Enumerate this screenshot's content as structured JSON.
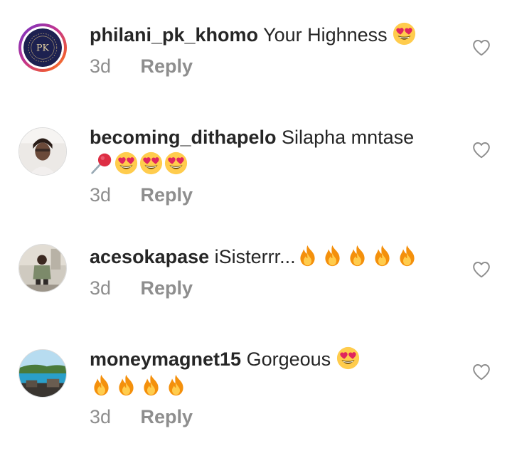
{
  "comments": [
    {
      "username": "philani_pk_khomo",
      "text": "Your Highness",
      "emojis_line1": [
        "heart-eyes-emoji"
      ],
      "emojis_line2": [],
      "time": "3d",
      "reply_label": "Reply",
      "avatar_monogram": "PK",
      "has_story_ring": true
    },
    {
      "username": "becoming_dithapelo",
      "text": "Silapha mntase",
      "emojis_line1": [],
      "emojis_line2": [
        "pushpin-emoji",
        "heart-eyes-emoji",
        "heart-eyes-emoji",
        "heart-eyes-emoji"
      ],
      "time": "3d",
      "reply_label": "Reply",
      "has_story_ring": false
    },
    {
      "username": "acesokapase",
      "text": "iSisterrr...",
      "emojis_line1": [
        "fire-emoji",
        "fire-emoji",
        "fire-emoji",
        "fire-emoji",
        "fire-emoji"
      ],
      "emojis_line2": [],
      "time": "3d",
      "reply_label": "Reply",
      "has_story_ring": false
    },
    {
      "username": "moneymagnet15",
      "text": "Gorgeous",
      "emojis_line1": [
        "heart-eyes-emoji"
      ],
      "emojis_line2": [
        "fire-emoji",
        "fire-emoji",
        "fire-emoji",
        "fire-emoji"
      ],
      "time": "3d",
      "reply_label": "Reply",
      "has_story_ring": false
    }
  ],
  "colors": {
    "text": "#262626",
    "secondary_text": "#8e8e8e",
    "heart_outline": "#8e8e8e",
    "story_ring_start": "#6f34c9",
    "story_ring_end": "#f6a33a"
  },
  "icons": {
    "like": "heart-outline-icon"
  }
}
